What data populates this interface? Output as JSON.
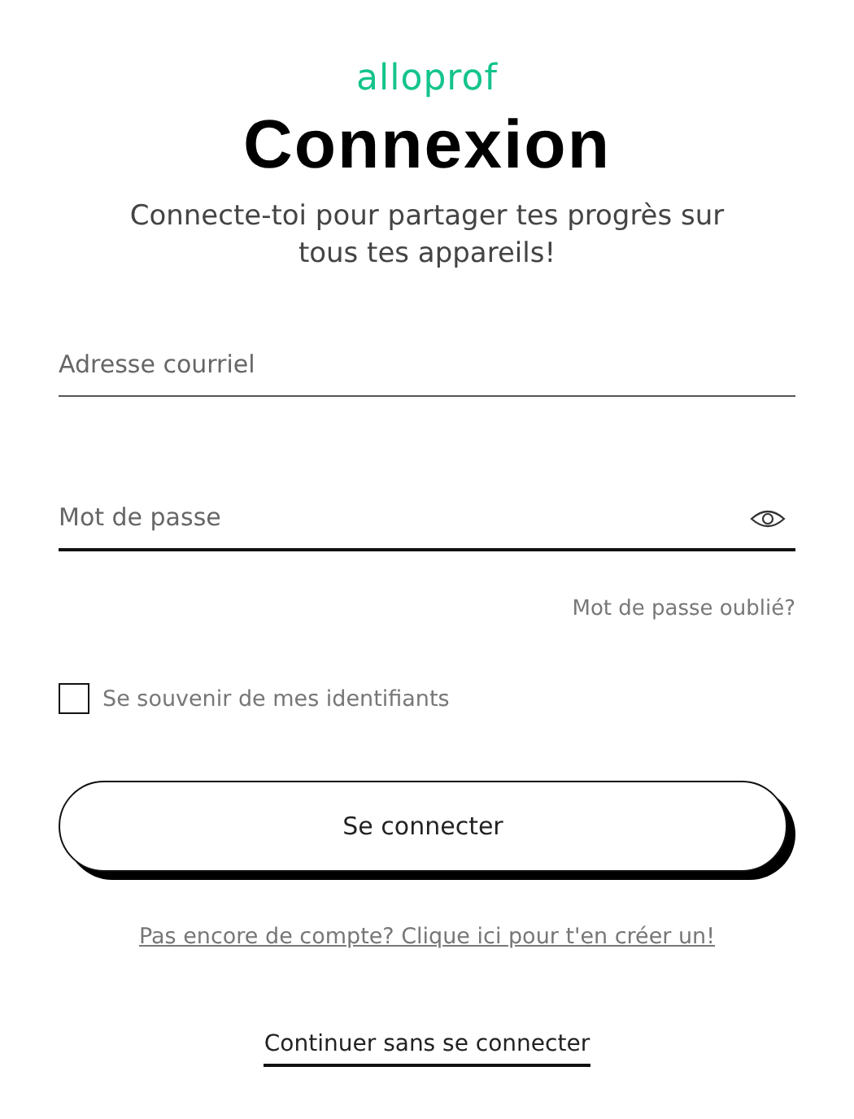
{
  "logo": "alloprof",
  "title": "Connexion",
  "subtitle": "Connecte-toi pour partager tes progrès sur tous tes appareils!",
  "fields": [
    {
      "placeholder": "Adresse courriel",
      "kind": "email",
      "focused": false
    },
    {
      "placeholder": "Mot de passe",
      "kind": "password",
      "focused": true
    }
  ],
  "forgot_link": "Mot de passe oublié?",
  "remember": {
    "label": "Se souvenir de mes identifiants",
    "checked": false
  },
  "submit_button": "Se connecter",
  "signup_link": "Pas encore de compte? Clique ici pour t'en créer un!",
  "continue_link": "Continuer sans se connecter"
}
